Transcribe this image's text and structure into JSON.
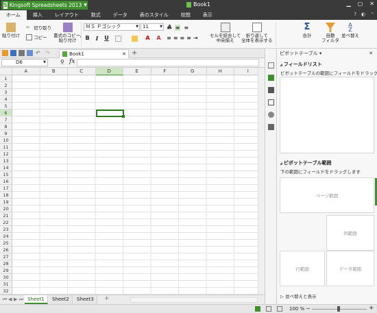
{
  "app": {
    "name": "Kingsoft Spreadsheets 2013",
    "doc_title": "Book1"
  },
  "menu": {
    "tabs": [
      "ホーム",
      "挿入",
      "レイアウト",
      "数式",
      "データ",
      "表のスタイル",
      "校閲",
      "表示"
    ],
    "active": 0
  },
  "ribbon": {
    "paste": "貼り付け",
    "cut": "切り取り",
    "copy": "コピー",
    "format_copy": "書式のコピー/\n貼り付け",
    "font": "ＭＳ Ｐゴシック",
    "size": "11",
    "merge": "セルを結合して\n中央揃え",
    "wrap": "折り返して\n全体を表示する",
    "sum": "合計",
    "autofilter": "自動\nフィルタ",
    "sort": "並べ替え"
  },
  "file_tab": {
    "label": "Book1"
  },
  "name_box": "D6",
  "fx": "fx",
  "columns": [
    "A",
    "B",
    "C",
    "D",
    "E",
    "F",
    "G",
    "H",
    "I"
  ],
  "selected_col": "D",
  "rows": [
    "1",
    "2",
    "3",
    "4",
    "5",
    "6",
    "7",
    "8",
    "9",
    "10",
    "11",
    "12",
    "13",
    "14",
    "15",
    "16",
    "17",
    "18",
    "19",
    "20",
    "21",
    "22",
    "23",
    "24",
    "25",
    "26",
    "27",
    "28",
    "29",
    "30",
    "31",
    "32"
  ],
  "selected_row": "6",
  "sheets": [
    "Sheet1",
    "Sheet2",
    "Sheet3"
  ],
  "active_sheet": 0,
  "panel": {
    "title": "ピボットテーブル",
    "field_list": "フィールドリスト",
    "field_hint": "ピボットテーブルの範囲にフィールドをドラッグします",
    "range": "ピボットテーブル範囲",
    "range_hint": "下の範囲にフィールドをドラッグします",
    "page": "ページ範囲",
    "col": "列範囲",
    "row": "行範囲",
    "data": "データ範囲",
    "sort": "並べ替えと表示"
  },
  "status": {
    "zoom": "100 %"
  },
  "colors": {
    "accent": "#3f8f2c",
    "titlebar": "#3a3a3a"
  }
}
